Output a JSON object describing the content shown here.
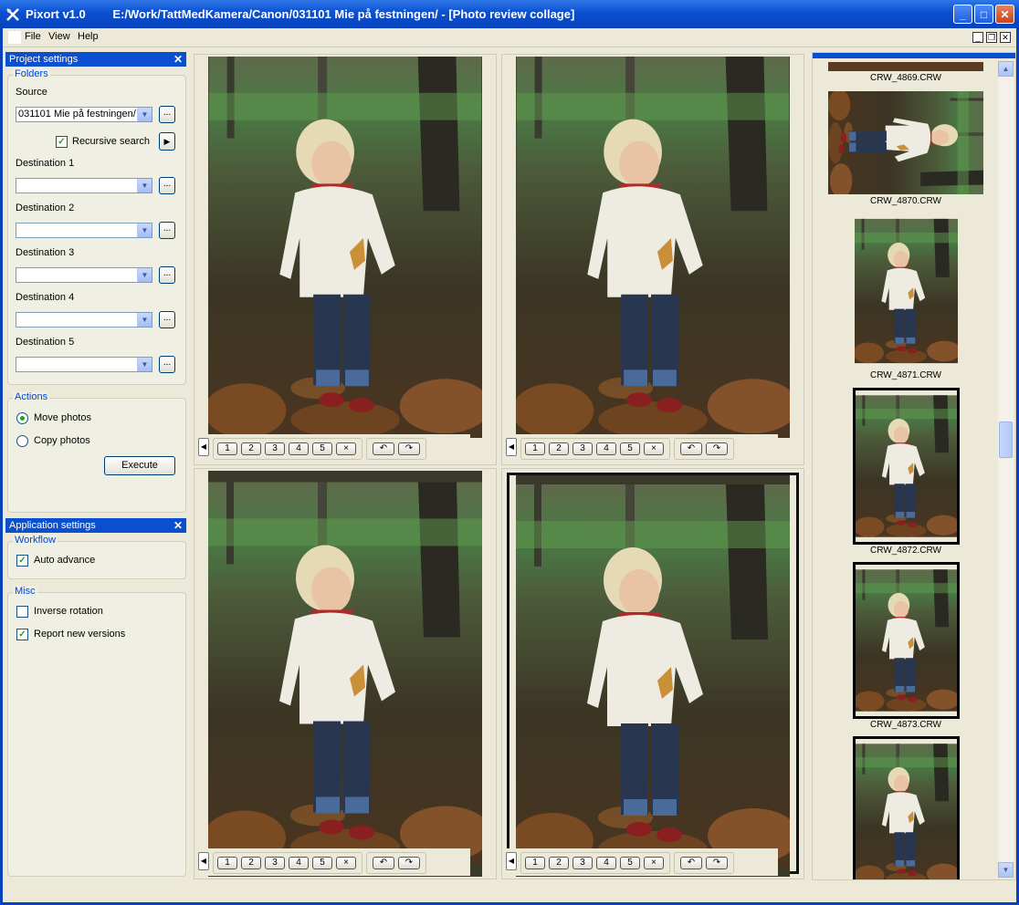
{
  "window": {
    "app_title": "Pixort v1.0",
    "path": "E:/Work/TattMedKamera/Canon/031101 Mie på festningen/ - [Photo review collage]",
    "minimize": "_",
    "maximize": "□",
    "close": "✕"
  },
  "menu": {
    "file": "File",
    "view": "View",
    "help": "Help"
  },
  "project_panel": {
    "title": "Project settings",
    "folders_legend": "Folders",
    "source_label": "Source",
    "source_value": "031101 Mie på festningen/",
    "recursive_label": "Recursive search",
    "recursive_checked": true,
    "destinations": [
      {
        "label": "Destination 1",
        "value": ""
      },
      {
        "label": "Destination 2",
        "value": ""
      },
      {
        "label": "Destination 3",
        "value": ""
      },
      {
        "label": "Destination 4",
        "value": ""
      },
      {
        "label": "Destination 5",
        "value": ""
      }
    ],
    "browse": "...",
    "actions_legend": "Actions",
    "move_label": "Move photos",
    "copy_label": "Copy photos",
    "execute": "Execute"
  },
  "app_panel": {
    "title": "Application settings",
    "workflow_legend": "Workflow",
    "auto_advance": "Auto advance",
    "misc_legend": "Misc",
    "inverse_rotation": "Inverse rotation",
    "report_versions": "Report new versions"
  },
  "photo_toolbar": {
    "dest_buttons": [
      "1",
      "2",
      "3",
      "4",
      "5",
      "×"
    ],
    "rotate_left": "↶",
    "rotate_right": "↷"
  },
  "thumbnails": [
    {
      "name": "CRW_4869.CRW"
    },
    {
      "name": "CRW_4870.CRW"
    },
    {
      "name": "CRW_4871.CRW"
    },
    {
      "name": "CRW_4872.CRW"
    },
    {
      "name": "CRW_4873.CRW"
    }
  ],
  "colors": {
    "accent": "#0a4fd0",
    "legend": "#0046d5",
    "check": "#21a121"
  }
}
